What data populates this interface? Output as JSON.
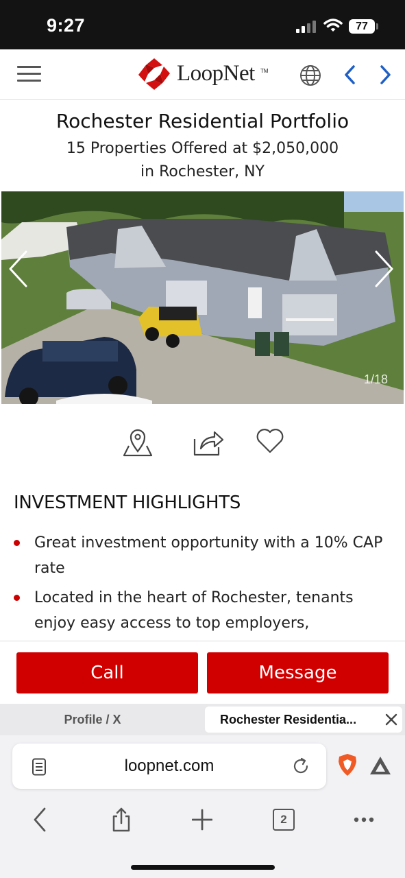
{
  "status_bar": {
    "time": "9:27",
    "battery": "77"
  },
  "header": {
    "brand": "LoopNet",
    "trademark": "TM"
  },
  "listing": {
    "title": "Rochester Residential Portfolio",
    "subtitle_line1": "15 Properties Offered at $2,050,000",
    "subtitle_line2": "in Rochester, NY",
    "photo_counter": "1/18"
  },
  "highlights": {
    "heading": "INVESTMENT HIGHLIGHTS",
    "items": [
      "Great investment opportunity with a 10% CAP rate",
      "Located in the heart of Rochester, tenants enjoy easy access to top employers,"
    ]
  },
  "actions": {
    "call_label": "Call",
    "message_label": "Message"
  },
  "browser": {
    "tabs": [
      {
        "label": "Profile / X"
      },
      {
        "label": "Rochester Residentia..."
      }
    ],
    "url": "loopnet.com",
    "open_tab_count": "2"
  },
  "colors": {
    "brand_red": "#d10000",
    "bullet_red": "#cc0000",
    "nav_blue": "#1f5fc4"
  }
}
